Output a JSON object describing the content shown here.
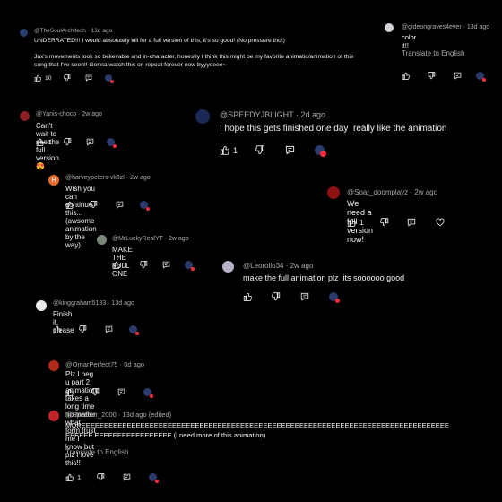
{
  "comments": [
    {
      "handle": "@TheSoulArchitech",
      "age": "13d ago",
      "body": "UNDERRATED!!! I would absolutely kill for a full version of this, it's so good! (No pressure tho!)\n\nJax's movements look so believable and in-character, honestly I think this might be my favorite animatic/animation of this song that I've seen!! Gonna watch this on repeat forever now byyyeeee~",
      "likes": "10",
      "translate": "",
      "avatar_color": "#27406b"
    },
    {
      "handle": "@gideongraves4ever",
      "age": "13d ago",
      "body": "color it!!",
      "likes": "",
      "translate": "Translate to English",
      "avatar_color": "#cfd3d8"
    },
    {
      "handle": "@Yanis-choco",
      "age": "2w ago",
      "body": "Can't wait to see the full version. 😍",
      "likes": "1",
      "translate": "",
      "avatar_color": "#8a1f24"
    },
    {
      "handle": "@SPEEDYJBLIGHT",
      "age": "2d ago",
      "body": "I hope this gets finished one day  really like the animation",
      "likes": "1",
      "translate": "",
      "avatar_color": "#1b2a55"
    },
    {
      "handle": "@harveypeters-vk8zl",
      "age": "2w ago",
      "body": "Wish you can continue this... (awsome animation by the way)",
      "likes": "",
      "translate": "",
      "avatar_color": "#e36a2a",
      "avatar_letter": "H"
    },
    {
      "handle": "@Soar_doomplayz",
      "age": "2w ago",
      "body": "We need a full version now!",
      "likes": "1",
      "translate": "",
      "avatar_color": "#8d1111"
    },
    {
      "handle": "@MrLuckyRealYT",
      "age": "2w ago",
      "body": "MAKE THE FULL ONE",
      "likes": "1",
      "translate": "",
      "avatar_color": "#7a8a7a"
    },
    {
      "handle": "@Leorollo34",
      "age": "2w ago",
      "body": "make the full animation plz  its soooooo good",
      "likes": "",
      "translate": "",
      "avatar_color": "#b8b0c8"
    },
    {
      "handle": "@kinggraham5183",
      "age": "13d ago",
      "body": "Finish it, please",
      "likes": "",
      "translate": "",
      "avatar_color": "#e8e8e8"
    },
    {
      "handle": "@OmarPerfect75",
      "age": "6d ago",
      "body": "Plz I beg u part 2 animation takes a long time no matter what form trust me I know but plz I love this!!",
      "likes": "",
      "translate": "",
      "avatar_color": "#b02a1a"
    },
    {
      "handle": "@Speeder_2000",
      "age": "13d ago (edited)",
      "body": "MOREEEEEEEEEEEEEEEEEEEEEEEEEEEEEEEEEEEEEEEEEEEEEEEEEEEEEEEEEEEEEEEEEEEEEEEEEEEEEEEEEEEEEEE EEEEEEEEEEEEEEEEE (i need more of this animation)",
      "likes": "1",
      "translate": "Translate to English",
      "avatar_color": "#c2222a"
    }
  ],
  "colors": {
    "background": "#000000",
    "text": "#f1f1f1",
    "muted": "#aaaaaa",
    "heart": "#ff2b3d"
  },
  "icons": [
    "thumbs-up-icon",
    "thumbs-down-icon",
    "reply-icon",
    "creator-heart-icon",
    "like-heart-icon"
  ]
}
